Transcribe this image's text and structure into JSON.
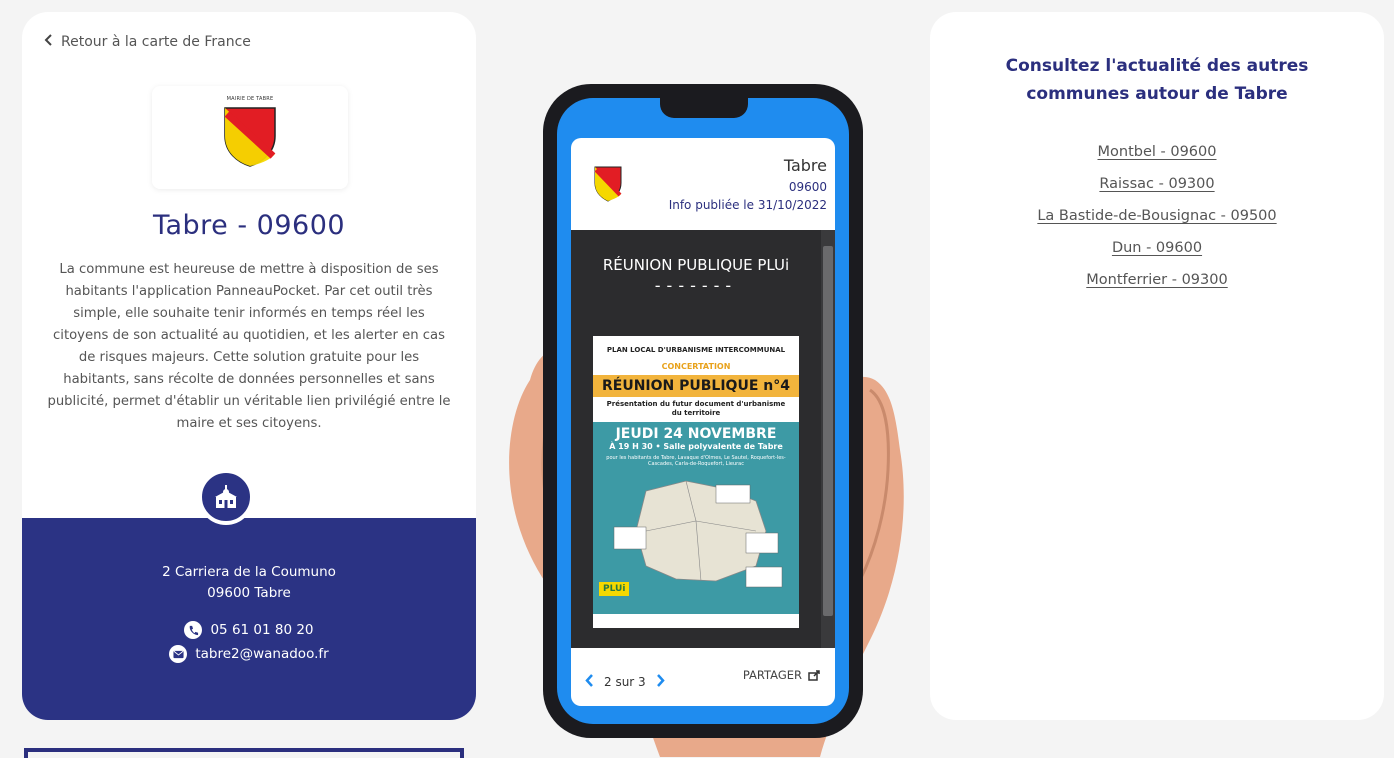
{
  "left_panel": {
    "back_link": "Retour à la carte de France",
    "logo_caption": "MAIRIE DE TABRE",
    "title": "Tabre - 09600",
    "description": "La commune est heureuse de mettre à disposition de ses habitants l'application PanneauPocket. Par cet outil très simple, elle souhaite tenir informés en temps réel les citoyens de son actualité au quotidien, et les alerter en cas de risques majeurs. Cette solution gratuite pour les habitants, sans récolte de données personnelles et sans publicité, permet d'établir un véritable lien privilégié entre le maire et ses citoyens.",
    "address_line1": "2 Carriera de la Coumuno",
    "address_line2": "09600 Tabre",
    "phone": "05 61 01 80 20",
    "email": "tabre2@wanadoo.fr"
  },
  "phone_app": {
    "town": "Tabre",
    "postcode": "09600",
    "published": "Info publiée le 31/10/2022",
    "post_title": "RÉUNION PUBLIQUE PLUi",
    "post_dashes": "-------",
    "poster": {
      "line1": "PLAN LOCAL D'URBANISME INTERCOMMUNAL",
      "line2": "CONCERTATION",
      "line3": "RÉUNION PUBLIQUE n°4",
      "line4": "Présentation du futur document d'urbanisme du territoire",
      "line5": "JEUDI 24 NOVEMBRE",
      "line6": "À 19 H 30 • Salle polyvalente de Tabre",
      "line7": "pour les habitants de Tabre, Lavaque d'Olmes, Le Sautel, Roquefort-les-Cascades, Carla-de-Roquefort, Lieurac",
      "badge": "PLUi"
    },
    "pager": "2 sur 3",
    "share": "PARTAGER"
  },
  "right_panel": {
    "title": "Consultez l'actualité des autres communes autour de Tabre",
    "neighbours": [
      "Montbel - 09600",
      "Raissac - 09300",
      "La Bastide-de-Bousignac - 09500",
      "Dun - 09600",
      "Montferrier - 09300"
    ]
  },
  "colors": {
    "brand_blue": "#2b3384",
    "app_blue": "#1f8cef",
    "poster_teal": "#3d9aa5",
    "poster_orange": "#f2b43c"
  },
  "icons": [
    "chevron-left-icon",
    "coat-of-arms-icon",
    "town-hall-icon",
    "phone-icon",
    "mail-icon",
    "share-icon",
    "chevron-right-icon"
  ]
}
